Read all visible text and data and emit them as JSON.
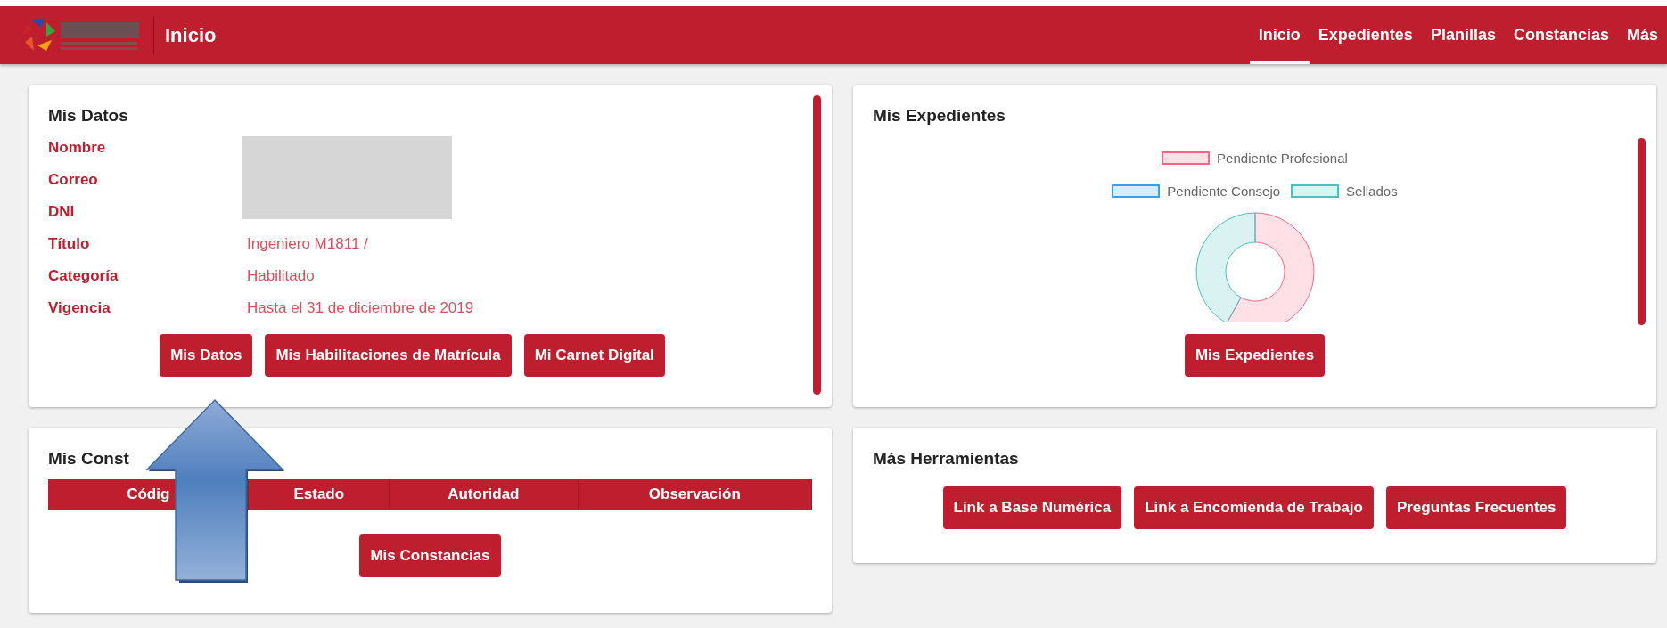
{
  "header": {
    "title": "Inicio",
    "nav": [
      {
        "label": "Inicio",
        "selected": true
      },
      {
        "label": "Expedientes",
        "selected": false
      },
      {
        "label": "Planillas",
        "selected": false
      },
      {
        "label": "Constancias",
        "selected": false
      },
      {
        "label": "Más",
        "selected": false
      }
    ]
  },
  "mis_datos": {
    "title": "Mis Datos",
    "redacted": true,
    "fields": [
      {
        "label": "Nombre"
      },
      {
        "label": "Correo"
      },
      {
        "label": "DNI"
      },
      {
        "label": "Título",
        "value": "Ingeniero M1811 /"
      },
      {
        "label": "Categoría",
        "value": "Habilitado"
      },
      {
        "label": "Vigencia",
        "value": "Hasta el 31 de diciembre de 2019"
      }
    ],
    "buttons": [
      "Mis Datos",
      "Mis Habilitaciones de Matrícula",
      "Mi Carnet Digital"
    ]
  },
  "mis_expedientes": {
    "title": "Mis Expedientes",
    "legend": [
      {
        "label": "Pendiente Profesional",
        "color": "#ff6384"
      },
      {
        "label": "Pendiente Consejo",
        "color": "#36a2eb"
      },
      {
        "label": "Sellados",
        "color": "#4bc0c0"
      }
    ],
    "button": "Mis Expedientes"
  },
  "mis_constancias": {
    "title": "Mis Const",
    "columns": [
      "Códig",
      "Estado",
      "Autoridad",
      "Observación"
    ],
    "button": "Mis Constancias"
  },
  "mas_herramientas": {
    "title": "Más Herramientas",
    "buttons": [
      "Link a Base Numérica",
      "Link a Encomienda de Trabajo",
      "Preguntas Frecuentes"
    ]
  },
  "annotation": {
    "kind": "arrow"
  }
}
